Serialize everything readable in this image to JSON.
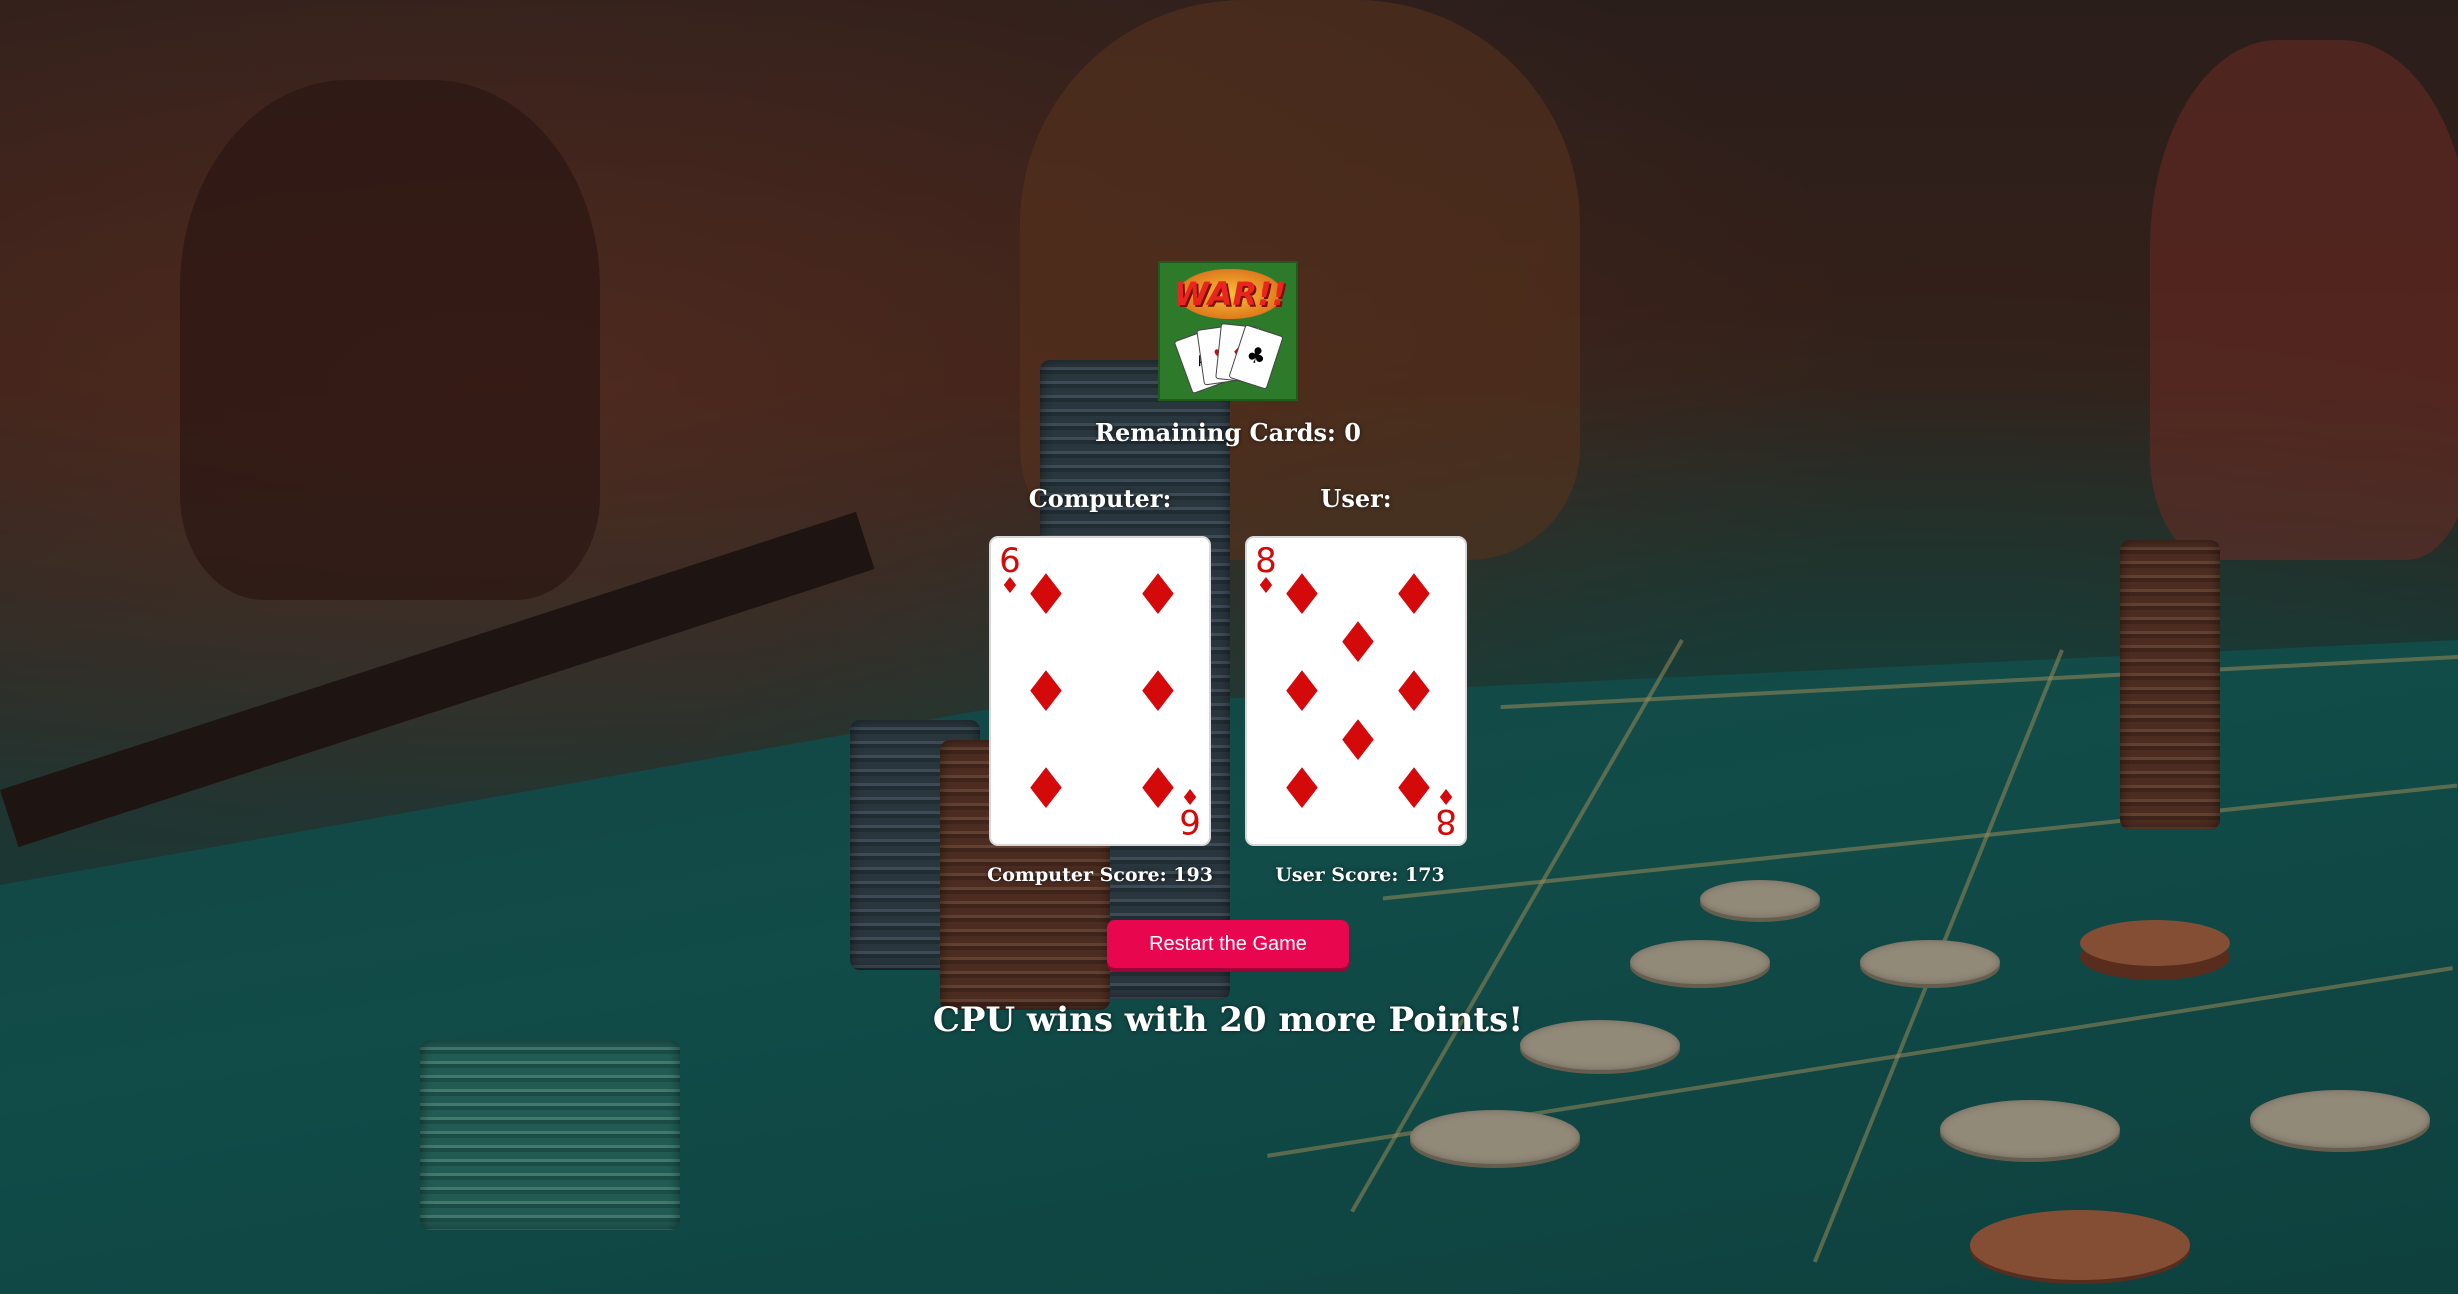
{
  "game": {
    "remaining_label": "Remaining Cards: 0",
    "computer_label": "Computer:",
    "user_label": "User:",
    "computer_card": {
      "rank": "6",
      "suit": "♦",
      "suit_name": "diamonds"
    },
    "user_card": {
      "rank": "8",
      "suit": "♦",
      "suit_name": "diamonds"
    },
    "computer_score": "Computer Score: 193",
    "user_score": "User Score: 173",
    "restart_label": "Restart the Game",
    "result_message": "CPU wins with 20 more Points!"
  },
  "logo": {
    "text": "WAR!!",
    "mini_cards": [
      "A",
      "♥",
      "♦",
      "♣"
    ]
  },
  "colors": {
    "button": "#e8064f",
    "suit_red": "#d40a0a",
    "logo_green": "#2d7a2a"
  }
}
